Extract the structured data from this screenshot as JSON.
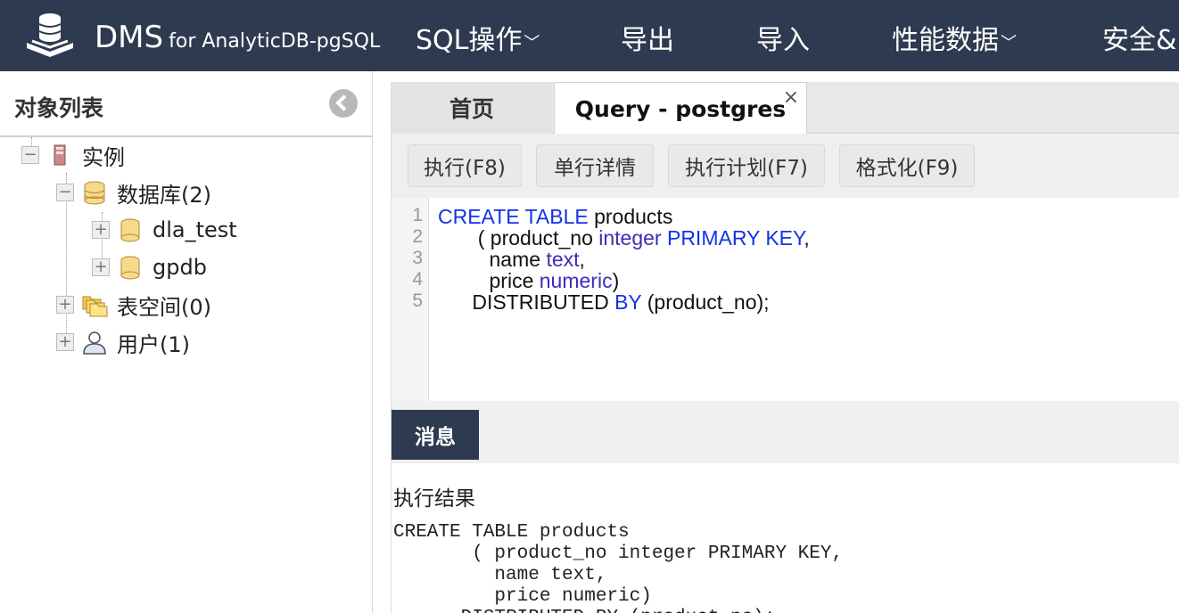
{
  "app": {
    "name": "DMS",
    "subtitle": "for AnalyticDB-pgSQL"
  },
  "nav": [
    {
      "label": "SQL操作",
      "has_caret": true
    },
    {
      "label": "导出",
      "has_caret": false
    },
    {
      "label": "导入",
      "has_caret": false
    },
    {
      "label": "性能数据",
      "has_caret": true
    },
    {
      "label": "安全&",
      "has_caret": false
    }
  ],
  "left_panel": {
    "title": "对象列表",
    "tree": {
      "instance": "实例",
      "database": "数据库(2)",
      "db_items": [
        "dla_test",
        "gpdb"
      ],
      "tablespace": "表空间(0)",
      "users": "用户(1)"
    }
  },
  "tabs": {
    "home": "首页",
    "query": "Query - postgres",
    "close_glyph": "×"
  },
  "toolbar": {
    "execute": "执行(F8)",
    "row_detail": "单行详情",
    "plan": "执行计划(F7)",
    "format": "格式化(F9)"
  },
  "editor": {
    "line_numbers": [
      "1",
      "2",
      "3",
      "4",
      "5"
    ],
    "lines": [
      [
        {
          "t": "CREATE TABLE",
          "c": "kw"
        },
        {
          "t": " products",
          "c": ""
        }
      ],
      [
        {
          "t": "       ( product_no ",
          "c": ""
        },
        {
          "t": "integer",
          "c": "ty"
        },
        {
          "t": " ",
          "c": ""
        },
        {
          "t": "PRIMARY KEY",
          "c": "kw"
        },
        {
          "t": ",",
          "c": ""
        }
      ],
      [
        {
          "t": "         name ",
          "c": ""
        },
        {
          "t": "text",
          "c": "ty"
        },
        {
          "t": ",",
          "c": ""
        }
      ],
      [
        {
          "t": "         price ",
          "c": ""
        },
        {
          "t": "numeric",
          "c": "ty"
        },
        {
          "t": ")",
          "c": ""
        }
      ],
      [
        {
          "t": "      DISTRIBUTED ",
          "c": ""
        },
        {
          "t": "BY",
          "c": "kw"
        },
        {
          "t": " (product_no);",
          "c": ""
        }
      ]
    ]
  },
  "messages": {
    "tab": "消息",
    "result_title": "执行结果",
    "result_text": "CREATE TABLE products\n       ( product_no integer PRIMARY KEY,\n         name text,\n         price numeric)\n      DISTRIBUTED BY (product_no);"
  },
  "colors": {
    "topbar": "#2e3a4f",
    "keyword": "#1432e6",
    "type": "#3b2db8"
  }
}
